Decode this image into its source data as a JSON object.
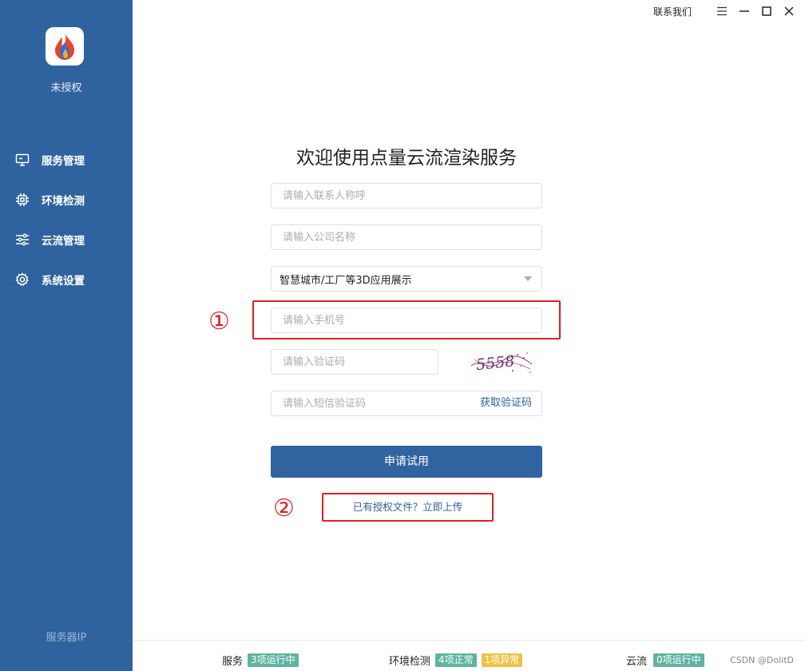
{
  "sidebar": {
    "auth_status": "未授权",
    "items": [
      {
        "label": "服务管理",
        "icon": "monitor-icon"
      },
      {
        "label": "环境检测",
        "icon": "chip-icon"
      },
      {
        "label": "云流管理",
        "icon": "sliders-icon"
      },
      {
        "label": "系统设置",
        "icon": "gear-icon"
      }
    ],
    "server_ip_label": "服务器IP"
  },
  "titlebar": {
    "contact_label": "联系我们",
    "icons": [
      "menu-icon",
      "minimize-icon",
      "maximize-icon",
      "close-icon"
    ]
  },
  "form": {
    "title": "欢迎使用点量云流渲染服务",
    "contact_placeholder": "请输入联系人称呼",
    "company_placeholder": "请输入公司名称",
    "usage_selected": "智慧城市/工厂等3D应用展示",
    "phone_placeholder": "请输入手机号",
    "captcha_placeholder": "请输入验证码",
    "captcha_text": "5558",
    "sms_placeholder": "请输入短信验证码",
    "get_code_label": "获取验证码",
    "submit_label": "申请试用",
    "upload_link": "已有授权文件？立即上传"
  },
  "annotations": [
    "①",
    "②"
  ],
  "statusbar": {
    "service_label": "服务",
    "service_badge": "3项运行中",
    "env_label": "环境检测",
    "env_ok_badge": "4项正常",
    "env_err_badge": "1项异常",
    "stream_label": "云流",
    "stream_badge": "0项运行中",
    "watermark": "CSDN @DolitD"
  },
  "colors": {
    "sidebar": "#2f63a0",
    "primary_button": "#3064a1",
    "annotation_red": "#e02020",
    "badge_green": "#5fb3a2",
    "badge_yellow": "#f0c245"
  }
}
